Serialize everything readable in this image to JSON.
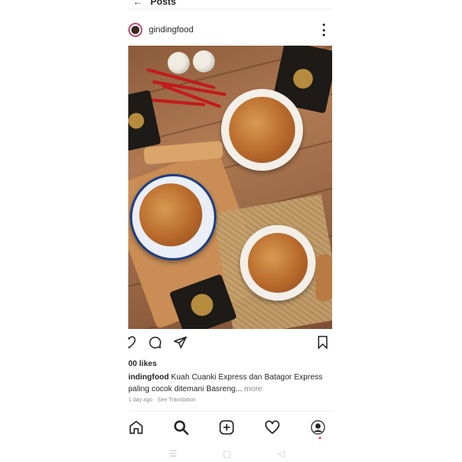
{
  "topbar": {
    "back_icon": "back-arrow-icon",
    "title": "Posts"
  },
  "post": {
    "username": "gindingfood",
    "likes": "00 likes",
    "caption_user": "indingfood",
    "caption_text": " Kuah Cuanki Express dan Batagor Express paling cocok ditemani Basreng...",
    "caption_more": " more",
    "timeline": "1 day ago · See Translation"
  },
  "actions": [
    "heart-icon",
    "comment-icon",
    "share-icon",
    "bookmark-icon"
  ],
  "nav": [
    "home-icon",
    "search-icon",
    "add-post-icon",
    "activity-heart-icon",
    "profile-avatar-icon"
  ],
  "system_nav": {
    "menu": "☰",
    "home": "▢",
    "back": "◁"
  }
}
